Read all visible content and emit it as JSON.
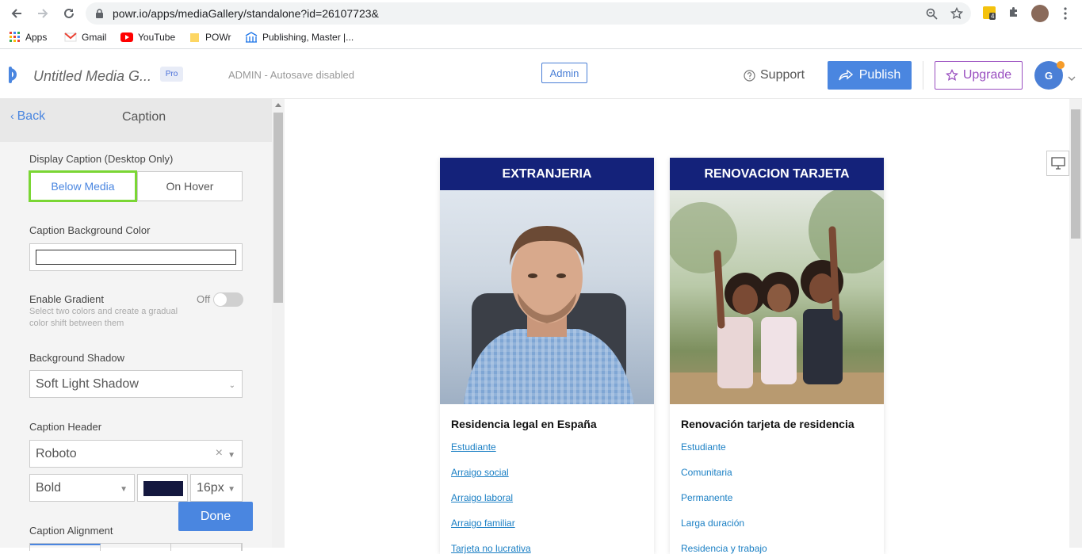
{
  "browser": {
    "url": "powr.io/apps/mediaGallery/standalone?id=26107723&",
    "bookmarks": [
      "Apps",
      "Gmail",
      "YouTube",
      "POWr",
      "Publishing, Master |..."
    ],
    "extension_badge": "4"
  },
  "header": {
    "app_title": "Untitled Media G...",
    "pro_badge": "Pro",
    "admin_status": "ADMIN - Autosave disabled",
    "admin_button": "Admin",
    "support_label": "Support",
    "publish_label": "Publish",
    "upgrade_label": "Upgrade",
    "avatar_initial": "G",
    "colors": {
      "publish": "#4a86e0",
      "upgrade": "#9a4fc0"
    }
  },
  "sidebar": {
    "back_label": "Back",
    "title": "Caption",
    "display_caption_label": "Display Caption (Desktop Only)",
    "display_options": [
      "Below Media",
      "On Hover"
    ],
    "display_selected": "Below Media",
    "bg_color_label": "Caption Background Color",
    "gradient_label": "Enable Gradient",
    "gradient_desc": "Select two colors and create a gradual color shift between them",
    "gradient_state": "Off",
    "shadow_label": "Background Shadow",
    "shadow_value": "Soft Light Shadow",
    "caption_header_label": "Caption Header",
    "font_value": "Roboto",
    "font_clear": "×",
    "weight_value": "Bold",
    "header_color": "#14183f",
    "size_value": "16px",
    "done_label": "Done",
    "alignment_label": "Caption Alignment"
  },
  "preview": {
    "cards": [
      {
        "header": "EXTRANJERIA",
        "title": "Residencia legal en España",
        "links": [
          "Estudiante",
          "Arraigo social",
          "Arraigo laboral",
          "Arraigo familiar",
          "Tarjeta no lucrativa"
        ]
      },
      {
        "header": "RENOVACION TARJETA",
        "title": "Renovación tarjeta de residencia",
        "links": [
          "Estudiante",
          "Comunitaria",
          "Permanente",
          "Larga duración",
          "Residencia y trabajo"
        ]
      }
    ],
    "header_color": "#14227a"
  }
}
